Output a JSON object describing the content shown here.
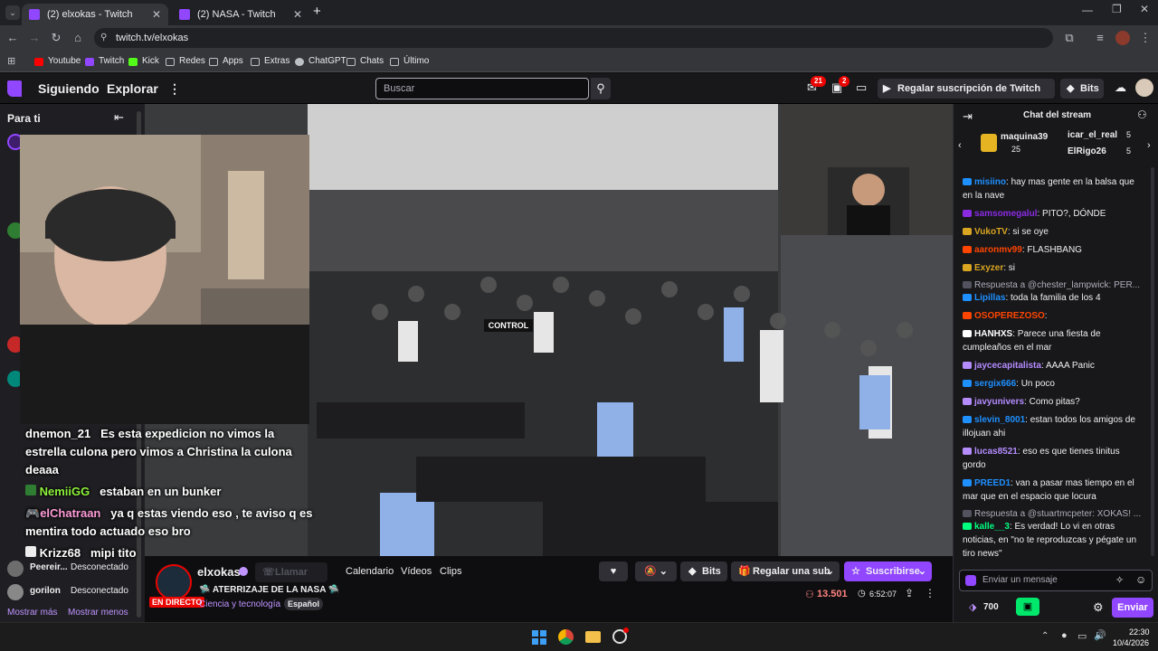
{
  "browser": {
    "tabs": [
      {
        "title": "(2) elxokas - Twitch",
        "active": true
      },
      {
        "title": "(2) NASA - Twitch",
        "active": false
      }
    ],
    "new_tab": "+",
    "url": "twitch.tv/elxokas",
    "bookmarks": [
      "Youtube",
      "Twitch",
      "Kick",
      "Redes",
      "Apps",
      "Extras",
      "ChatGPT",
      "Chats",
      "Último"
    ]
  },
  "twitch_nav": {
    "following": "Siguiendo",
    "browse": "Explorar",
    "search_placeholder": "Buscar",
    "inbox_badge": "21",
    "notif_badge": "2",
    "turbo": "Regalar suscripción de Twitch Turbo",
    "bits": "Bits"
  },
  "sidebar": {
    "title": "Para ti",
    "offline_channels": [
      {
        "name": "Peereir...",
        "status": "Desconectado"
      },
      {
        "name": "gorilon",
        "status": "Desconectado"
      }
    ],
    "show_more": "Mostrar más",
    "show_less": "Mostrar menos"
  },
  "video_overlay": {
    "messages": [
      {
        "user": "dnemon_21",
        "text": "Es esta expedicion no vimos la estrella culona pero vimos a Christina la culona deaaa",
        "color": "#ffffff"
      },
      {
        "user": "NemiiGG",
        "text": "estaban en un bunker",
        "color": "#8ef23b"
      },
      {
        "user": "elChatraan",
        "text": "ya q estas viendo eso , te aviso q es mentira todo actuado eso bro",
        "color": "#ff9cd9"
      },
      {
        "user": "Krizz68",
        "text": "mipi tito",
        "color": "#ffffff"
      }
    ],
    "control_sign": "CONTROL"
  },
  "stream": {
    "channel": "elxokas",
    "title": "🛸 ATERRIZAJE DE LA NASA 🛸",
    "category": "Ciencia y tecnología",
    "language_tag": "Español",
    "live_badge": "EN DIRECTO",
    "viewers": "13.501",
    "uptime": "6:52:07",
    "call_button": "Llamar",
    "tabs": [
      "Calendario",
      "Vídeos",
      "Clips"
    ],
    "bits": "Bits",
    "gift_sub": "Regalar una sub",
    "subscribe": "Suscribirse"
  },
  "chat": {
    "header": "Chat del stream",
    "leaderboard": [
      {
        "name": "maquina39",
        "value": "25"
      },
      {
        "name": "icar_el_real",
        "value": "5"
      },
      {
        "name": "ElRigo26",
        "value": "5"
      }
    ],
    "messages": [
      {
        "user": "misiino",
        "color": "#1e90ff",
        "text": ": hay mas gente en la balsa que en la nave"
      },
      {
        "user": "samsomegalul",
        "color": "#8a2be2",
        "text": ": PITO?, DÓNDE"
      },
      {
        "user": "VukoTV",
        "color": "#daa520",
        "text": ": si se oye"
      },
      {
        "user": "aaronmv99",
        "color": "#ff4500",
        "text": ": FLASHBANG"
      },
      {
        "user": "Exyzer",
        "color": "#daa520",
        "text": ": si"
      },
      {
        "user": "",
        "color": "#adadb8",
        "text": "Respuesta a @chester_lampwick: PER..."
      },
      {
        "user": "Lipillas",
        "color": "#1e90ff",
        "text": ": toda la familia de los 4"
      },
      {
        "user": "OSOPEREZOSO",
        "color": "#ff4500",
        "text": ":"
      },
      {
        "user": "HANHXS",
        "color": "#ffffff",
        "text": ": Parece una fiesta de cumpleaños en el mar"
      },
      {
        "user": "jaycecapitalista",
        "color": "#b58cff",
        "text": ": AAAA Panic"
      },
      {
        "user": "sergix666",
        "color": "#1e90ff",
        "text": ": Un poco"
      },
      {
        "user": "javyunivers",
        "color": "#b58cff",
        "text": ": Como pitas?"
      },
      {
        "user": "slevin_8001",
        "color": "#1e90ff",
        "text": ": estan todos los amigos de illojuan ahi"
      },
      {
        "user": "lucas8521",
        "color": "#b58cff",
        "text": ": eso es que tienes tinitus gordo"
      },
      {
        "user": "PREED1",
        "color": "#1e90ff",
        "text": ": van a pasar mas tiempo en el mar que en el espacio que locura"
      },
      {
        "user": "",
        "color": "#adadb8",
        "text": "Respuesta a @stuartmcpeter: XOKAS! ..."
      },
      {
        "user": "kalle__3",
        "color": "#00ff7f",
        "text": ": Es verdad! Lo vi en otras noticias, en \"no te reproduzcas y pégate un tiro news\""
      }
    ],
    "input_placeholder": "Enviar un mensaje",
    "points": "700",
    "send": "Enviar"
  },
  "taskbar": {
    "time": "22:30",
    "date": "10/4/2026"
  }
}
